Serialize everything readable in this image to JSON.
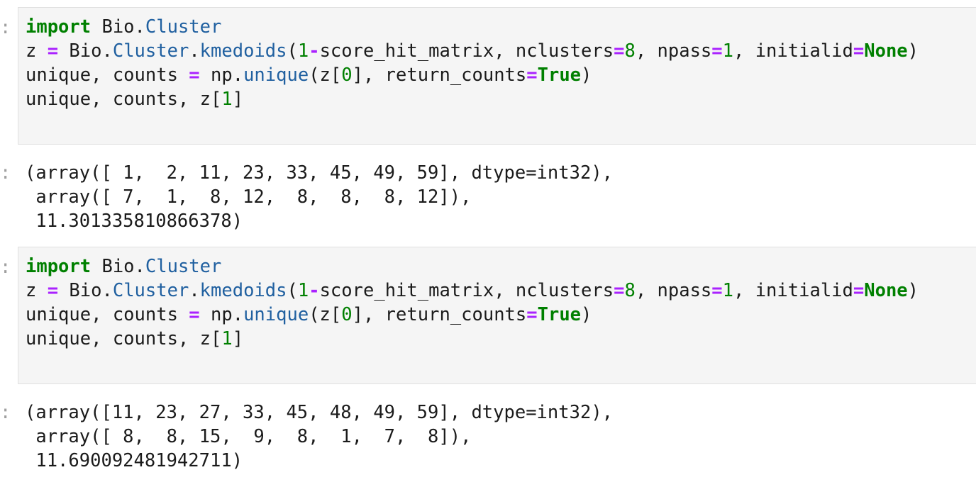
{
  "cells": [
    {
      "prompt_in": ":",
      "prompt_out": ":",
      "code_lines": [
        [
          {
            "t": "import",
            "c": "kw"
          },
          {
            "t": " Bio.",
            "c": "txt"
          },
          {
            "t": "Cluster",
            "c": "nm"
          }
        ],
        [
          {
            "t": "z ",
            "c": "txt"
          },
          {
            "t": "=",
            "c": "op"
          },
          {
            "t": " Bio.",
            "c": "txt"
          },
          {
            "t": "Cluster",
            "c": "nm"
          },
          {
            "t": ".",
            "c": "txt"
          },
          {
            "t": "kmedoids",
            "c": "nm"
          },
          {
            "t": "(",
            "c": "txt"
          },
          {
            "t": "1",
            "c": "num"
          },
          {
            "t": "-",
            "c": "op"
          },
          {
            "t": "score_hit_matrix, nclusters",
            "c": "txt"
          },
          {
            "t": "=",
            "c": "op"
          },
          {
            "t": "8",
            "c": "num"
          },
          {
            "t": ", npass",
            "c": "txt"
          },
          {
            "t": "=",
            "c": "op"
          },
          {
            "t": "1",
            "c": "num"
          },
          {
            "t": ", initialid",
            "c": "txt"
          },
          {
            "t": "=",
            "c": "op"
          },
          {
            "t": "None",
            "c": "kw"
          },
          {
            "t": ")",
            "c": "txt"
          }
        ],
        [
          {
            "t": "unique, counts ",
            "c": "txt"
          },
          {
            "t": "=",
            "c": "op"
          },
          {
            "t": " np.",
            "c": "txt"
          },
          {
            "t": "unique",
            "c": "nm"
          },
          {
            "t": "(z[",
            "c": "txt"
          },
          {
            "t": "0",
            "c": "num"
          },
          {
            "t": "], return_counts",
            "c": "txt"
          },
          {
            "t": "=",
            "c": "op"
          },
          {
            "t": "True",
            "c": "kw"
          },
          {
            "t": ")",
            "c": "txt"
          }
        ],
        [
          {
            "t": "unique, counts, z[",
            "c": "txt"
          },
          {
            "t": "1",
            "c": "num"
          },
          {
            "t": "]",
            "c": "txt"
          }
        ]
      ],
      "output_lines": [
        "(array([ 1,  2, 11, 23, 33, 45, 49, 59], dtype=int32),",
        " array([ 7,  1,  8, 12,  8,  8,  8, 12]),",
        " 11.301335810866378)"
      ]
    },
    {
      "prompt_in": ":",
      "prompt_out": ":",
      "code_lines": [
        [
          {
            "t": "import",
            "c": "kw"
          },
          {
            "t": " Bio.",
            "c": "txt"
          },
          {
            "t": "Cluster",
            "c": "nm"
          }
        ],
        [
          {
            "t": "z ",
            "c": "txt"
          },
          {
            "t": "=",
            "c": "op"
          },
          {
            "t": " Bio.",
            "c": "txt"
          },
          {
            "t": "Cluster",
            "c": "nm"
          },
          {
            "t": ".",
            "c": "txt"
          },
          {
            "t": "kmedoids",
            "c": "nm"
          },
          {
            "t": "(",
            "c": "txt"
          },
          {
            "t": "1",
            "c": "num"
          },
          {
            "t": "-",
            "c": "op"
          },
          {
            "t": "score_hit_matrix, nclusters",
            "c": "txt"
          },
          {
            "t": "=",
            "c": "op"
          },
          {
            "t": "8",
            "c": "num"
          },
          {
            "t": ", npass",
            "c": "txt"
          },
          {
            "t": "=",
            "c": "op"
          },
          {
            "t": "1",
            "c": "num"
          },
          {
            "t": ", initialid",
            "c": "txt"
          },
          {
            "t": "=",
            "c": "op"
          },
          {
            "t": "None",
            "c": "kw"
          },
          {
            "t": ")",
            "c": "txt"
          }
        ],
        [
          {
            "t": "unique, counts ",
            "c": "txt"
          },
          {
            "t": "=",
            "c": "op"
          },
          {
            "t": " np.",
            "c": "txt"
          },
          {
            "t": "unique",
            "c": "nm"
          },
          {
            "t": "(z[",
            "c": "txt"
          },
          {
            "t": "0",
            "c": "num"
          },
          {
            "t": "], return_counts",
            "c": "txt"
          },
          {
            "t": "=",
            "c": "op"
          },
          {
            "t": "True",
            "c": "kw"
          },
          {
            "t": ")",
            "c": "txt"
          }
        ],
        [
          {
            "t": "unique, counts, z[",
            "c": "txt"
          },
          {
            "t": "1",
            "c": "num"
          },
          {
            "t": "]",
            "c": "txt"
          }
        ]
      ],
      "output_lines": [
        "(array([11, 23, 27, 33, 45, 48, 49, 59], dtype=int32),",
        " array([ 8,  8, 15,  9,  8,  1,  7,  8]),",
        " 11.690092481942711)"
      ]
    }
  ],
  "colors": {
    "keyword": "#008000",
    "operator": "#aa22ff",
    "name": "#2060a0",
    "number": "#008000",
    "text": "#1b1b1b",
    "input_bg": "#f5f5f5",
    "input_border": "#e0e0e0",
    "prompt": "#a0a0a0"
  }
}
